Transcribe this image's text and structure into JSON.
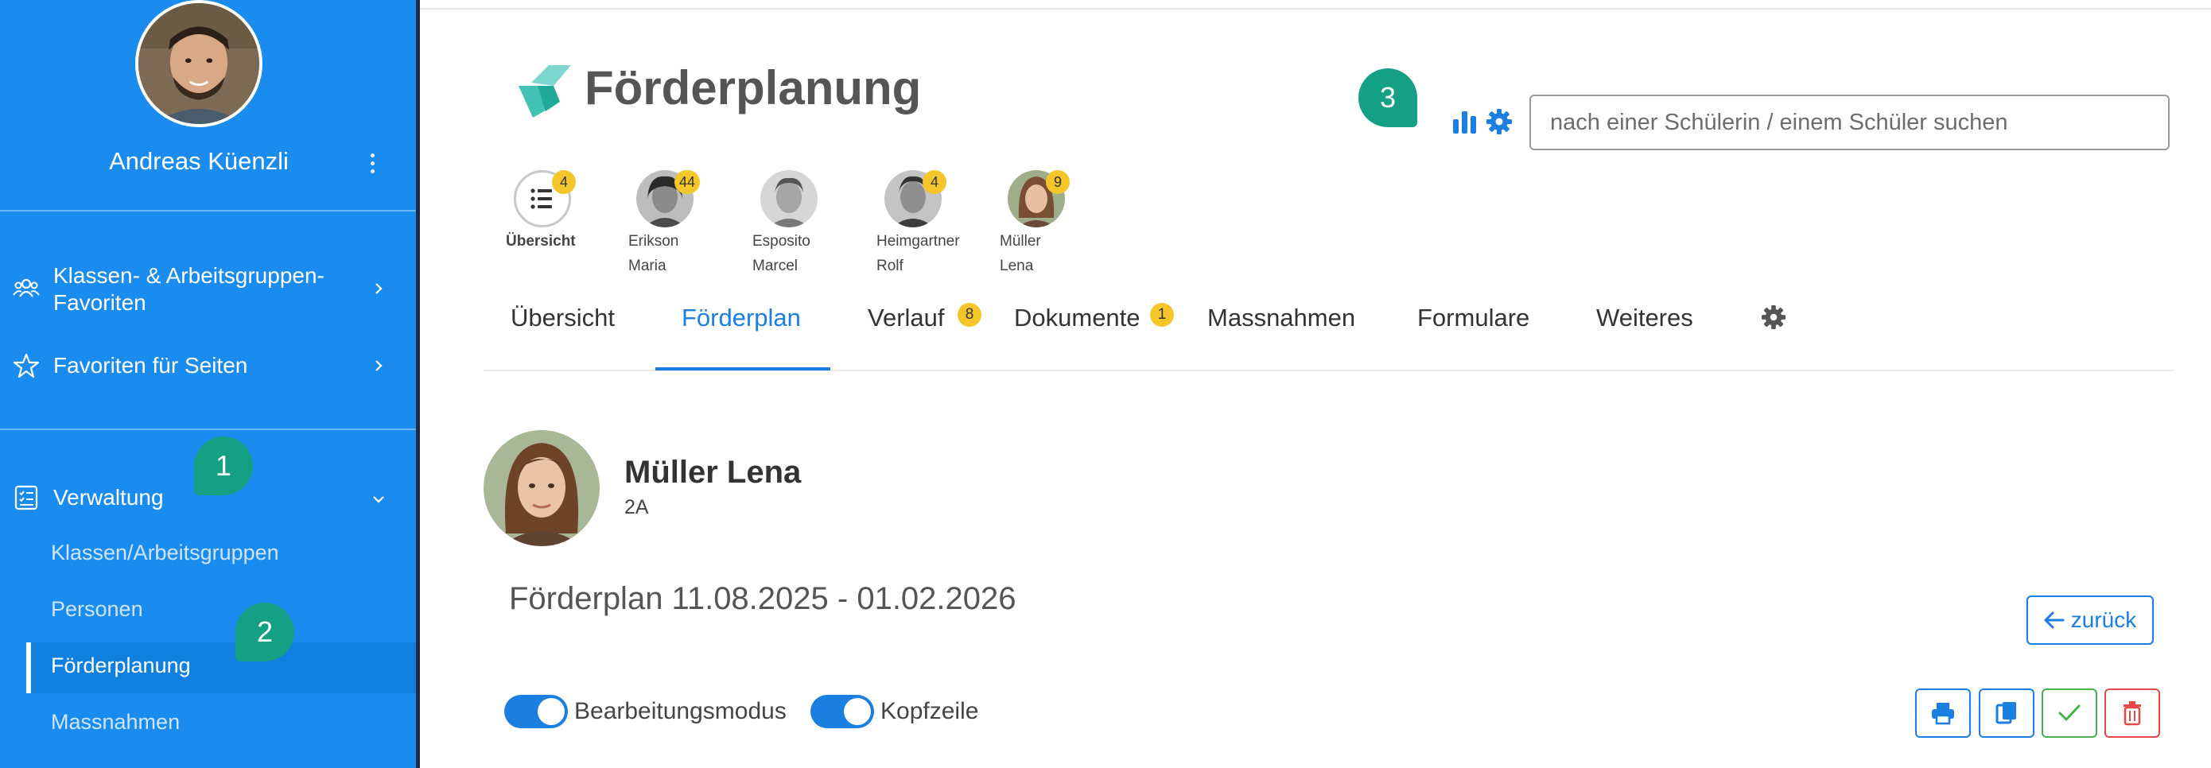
{
  "user": {
    "name": "Andreas Küenzli"
  },
  "sidebar": {
    "items": [
      {
        "label_line1": "Klassen- & Arbeitsgruppen-",
        "label_line2": "Favoriten"
      },
      {
        "label": "Favoriten für Seiten"
      },
      {
        "label": "Verwaltung"
      }
    ],
    "sub_items": [
      {
        "label": "Klassen/Arbeitsgruppen"
      },
      {
        "label": "Personen"
      },
      {
        "label": "Förderplanung"
      },
      {
        "label": "Massnahmen"
      }
    ]
  },
  "markers": [
    "1",
    "2",
    "3"
  ],
  "header": {
    "title": "Förderplanung"
  },
  "search": {
    "placeholder": "nach einer Schülerin / einem Schüler suchen"
  },
  "students": [
    {
      "line1": "Übersicht",
      "line2": "",
      "badge": "4"
    },
    {
      "line1": "Erikson",
      "line2": "Maria",
      "badge": "44"
    },
    {
      "line1": "Esposito",
      "line2": "Marcel",
      "badge": ""
    },
    {
      "line1": "Heimgartner",
      "line2": "Rolf",
      "badge": "4"
    },
    {
      "line1": "Müller",
      "line2": "Lena",
      "badge": "9"
    }
  ],
  "tabs": [
    {
      "label": "Übersicht",
      "badge": ""
    },
    {
      "label": "Förderplan",
      "badge": ""
    },
    {
      "label": "Verlauf",
      "badge": "8"
    },
    {
      "label": "Dokumente",
      "badge": "1"
    },
    {
      "label": "Massnahmen",
      "badge": ""
    },
    {
      "label": "Formulare",
      "badge": ""
    },
    {
      "label": "Weiteres",
      "badge": ""
    }
  ],
  "pupil": {
    "name": "Müller Lena",
    "class": "2A"
  },
  "plan": {
    "title": "Förderplan 11.08.2025 - 01.02.2026"
  },
  "back_button": {
    "label": "zurück"
  },
  "toggles": [
    {
      "label": "Bearbeitungsmodus",
      "on": true
    },
    {
      "label": "Kopfzeile",
      "on": true
    }
  ],
  "colors": {
    "sidebar": "#1a8cf0",
    "accent": "#1a7fe0",
    "marker": "#14a085",
    "badge": "#f5c62a",
    "ok": "#46b34a",
    "delete": "#e54848"
  },
  "icons": [
    "user-group-icon",
    "star-icon",
    "checklist-icon",
    "chevron-right-icon",
    "chevron-down-icon",
    "bar-chart-icon",
    "gear-icon",
    "list-icon",
    "arrow-left-icon",
    "print-icon",
    "copy-icon",
    "check-icon",
    "trash-icon",
    "kebab-menu-icon"
  ]
}
